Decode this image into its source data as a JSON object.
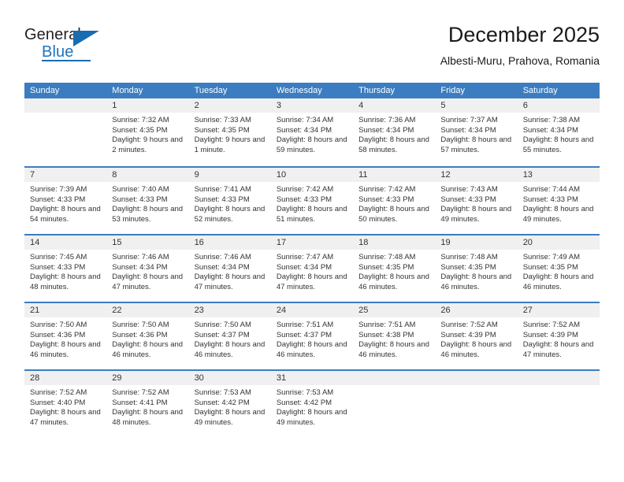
{
  "brand": {
    "word_one": "General",
    "word_two": "Blue",
    "triangle_icon": "triangle-icon",
    "accent_color": "#1a6cb0"
  },
  "header": {
    "title": "December 2025",
    "subtitle": "Albesti-Muru, Prahova, Romania"
  },
  "calendar": {
    "header_color": "#3b7dc0",
    "weekdays": [
      "Sunday",
      "Monday",
      "Tuesday",
      "Wednesday",
      "Thursday",
      "Friday",
      "Saturday"
    ],
    "weeks": [
      [
        {
          "day": "",
          "sunrise": "",
          "sunset": "",
          "daylight": "",
          "empty": true
        },
        {
          "day": "1",
          "sunrise": "Sunrise: 7:32 AM",
          "sunset": "Sunset: 4:35 PM",
          "daylight": "Daylight: 9 hours and 2 minutes."
        },
        {
          "day": "2",
          "sunrise": "Sunrise: 7:33 AM",
          "sunset": "Sunset: 4:35 PM",
          "daylight": "Daylight: 9 hours and 1 minute."
        },
        {
          "day": "3",
          "sunrise": "Sunrise: 7:34 AM",
          "sunset": "Sunset: 4:34 PM",
          "daylight": "Daylight: 8 hours and 59 minutes."
        },
        {
          "day": "4",
          "sunrise": "Sunrise: 7:36 AM",
          "sunset": "Sunset: 4:34 PM",
          "daylight": "Daylight: 8 hours and 58 minutes."
        },
        {
          "day": "5",
          "sunrise": "Sunrise: 7:37 AM",
          "sunset": "Sunset: 4:34 PM",
          "daylight": "Daylight: 8 hours and 57 minutes."
        },
        {
          "day": "6",
          "sunrise": "Sunrise: 7:38 AM",
          "sunset": "Sunset: 4:34 PM",
          "daylight": "Daylight: 8 hours and 55 minutes."
        }
      ],
      [
        {
          "day": "7",
          "sunrise": "Sunrise: 7:39 AM",
          "sunset": "Sunset: 4:33 PM",
          "daylight": "Daylight: 8 hours and 54 minutes."
        },
        {
          "day": "8",
          "sunrise": "Sunrise: 7:40 AM",
          "sunset": "Sunset: 4:33 PM",
          "daylight": "Daylight: 8 hours and 53 minutes."
        },
        {
          "day": "9",
          "sunrise": "Sunrise: 7:41 AM",
          "sunset": "Sunset: 4:33 PM",
          "daylight": "Daylight: 8 hours and 52 minutes."
        },
        {
          "day": "10",
          "sunrise": "Sunrise: 7:42 AM",
          "sunset": "Sunset: 4:33 PM",
          "daylight": "Daylight: 8 hours and 51 minutes."
        },
        {
          "day": "11",
          "sunrise": "Sunrise: 7:42 AM",
          "sunset": "Sunset: 4:33 PM",
          "daylight": "Daylight: 8 hours and 50 minutes."
        },
        {
          "day": "12",
          "sunrise": "Sunrise: 7:43 AM",
          "sunset": "Sunset: 4:33 PM",
          "daylight": "Daylight: 8 hours and 49 minutes."
        },
        {
          "day": "13",
          "sunrise": "Sunrise: 7:44 AM",
          "sunset": "Sunset: 4:33 PM",
          "daylight": "Daylight: 8 hours and 49 minutes."
        }
      ],
      [
        {
          "day": "14",
          "sunrise": "Sunrise: 7:45 AM",
          "sunset": "Sunset: 4:33 PM",
          "daylight": "Daylight: 8 hours and 48 minutes."
        },
        {
          "day": "15",
          "sunrise": "Sunrise: 7:46 AM",
          "sunset": "Sunset: 4:34 PM",
          "daylight": "Daylight: 8 hours and 47 minutes."
        },
        {
          "day": "16",
          "sunrise": "Sunrise: 7:46 AM",
          "sunset": "Sunset: 4:34 PM",
          "daylight": "Daylight: 8 hours and 47 minutes."
        },
        {
          "day": "17",
          "sunrise": "Sunrise: 7:47 AM",
          "sunset": "Sunset: 4:34 PM",
          "daylight": "Daylight: 8 hours and 47 minutes."
        },
        {
          "day": "18",
          "sunrise": "Sunrise: 7:48 AM",
          "sunset": "Sunset: 4:35 PM",
          "daylight": "Daylight: 8 hours and 46 minutes."
        },
        {
          "day": "19",
          "sunrise": "Sunrise: 7:48 AM",
          "sunset": "Sunset: 4:35 PM",
          "daylight": "Daylight: 8 hours and 46 minutes."
        },
        {
          "day": "20",
          "sunrise": "Sunrise: 7:49 AM",
          "sunset": "Sunset: 4:35 PM",
          "daylight": "Daylight: 8 hours and 46 minutes."
        }
      ],
      [
        {
          "day": "21",
          "sunrise": "Sunrise: 7:50 AM",
          "sunset": "Sunset: 4:36 PM",
          "daylight": "Daylight: 8 hours and 46 minutes."
        },
        {
          "day": "22",
          "sunrise": "Sunrise: 7:50 AM",
          "sunset": "Sunset: 4:36 PM",
          "daylight": "Daylight: 8 hours and 46 minutes."
        },
        {
          "day": "23",
          "sunrise": "Sunrise: 7:50 AM",
          "sunset": "Sunset: 4:37 PM",
          "daylight": "Daylight: 8 hours and 46 minutes."
        },
        {
          "day": "24",
          "sunrise": "Sunrise: 7:51 AM",
          "sunset": "Sunset: 4:37 PM",
          "daylight": "Daylight: 8 hours and 46 minutes."
        },
        {
          "day": "25",
          "sunrise": "Sunrise: 7:51 AM",
          "sunset": "Sunset: 4:38 PM",
          "daylight": "Daylight: 8 hours and 46 minutes."
        },
        {
          "day": "26",
          "sunrise": "Sunrise: 7:52 AM",
          "sunset": "Sunset: 4:39 PM",
          "daylight": "Daylight: 8 hours and 46 minutes."
        },
        {
          "day": "27",
          "sunrise": "Sunrise: 7:52 AM",
          "sunset": "Sunset: 4:39 PM",
          "daylight": "Daylight: 8 hours and 47 minutes."
        }
      ],
      [
        {
          "day": "28",
          "sunrise": "Sunrise: 7:52 AM",
          "sunset": "Sunset: 4:40 PM",
          "daylight": "Daylight: 8 hours and 47 minutes."
        },
        {
          "day": "29",
          "sunrise": "Sunrise: 7:52 AM",
          "sunset": "Sunset: 4:41 PM",
          "daylight": "Daylight: 8 hours and 48 minutes."
        },
        {
          "day": "30",
          "sunrise": "Sunrise: 7:53 AM",
          "sunset": "Sunset: 4:42 PM",
          "daylight": "Daylight: 8 hours and 49 minutes."
        },
        {
          "day": "31",
          "sunrise": "Sunrise: 7:53 AM",
          "sunset": "Sunset: 4:42 PM",
          "daylight": "Daylight: 8 hours and 49 minutes."
        },
        {
          "day": "",
          "sunrise": "",
          "sunset": "",
          "daylight": "",
          "empty": true
        },
        {
          "day": "",
          "sunrise": "",
          "sunset": "",
          "daylight": "",
          "empty": true
        },
        {
          "day": "",
          "sunrise": "",
          "sunset": "",
          "daylight": "",
          "empty": true
        }
      ]
    ]
  }
}
